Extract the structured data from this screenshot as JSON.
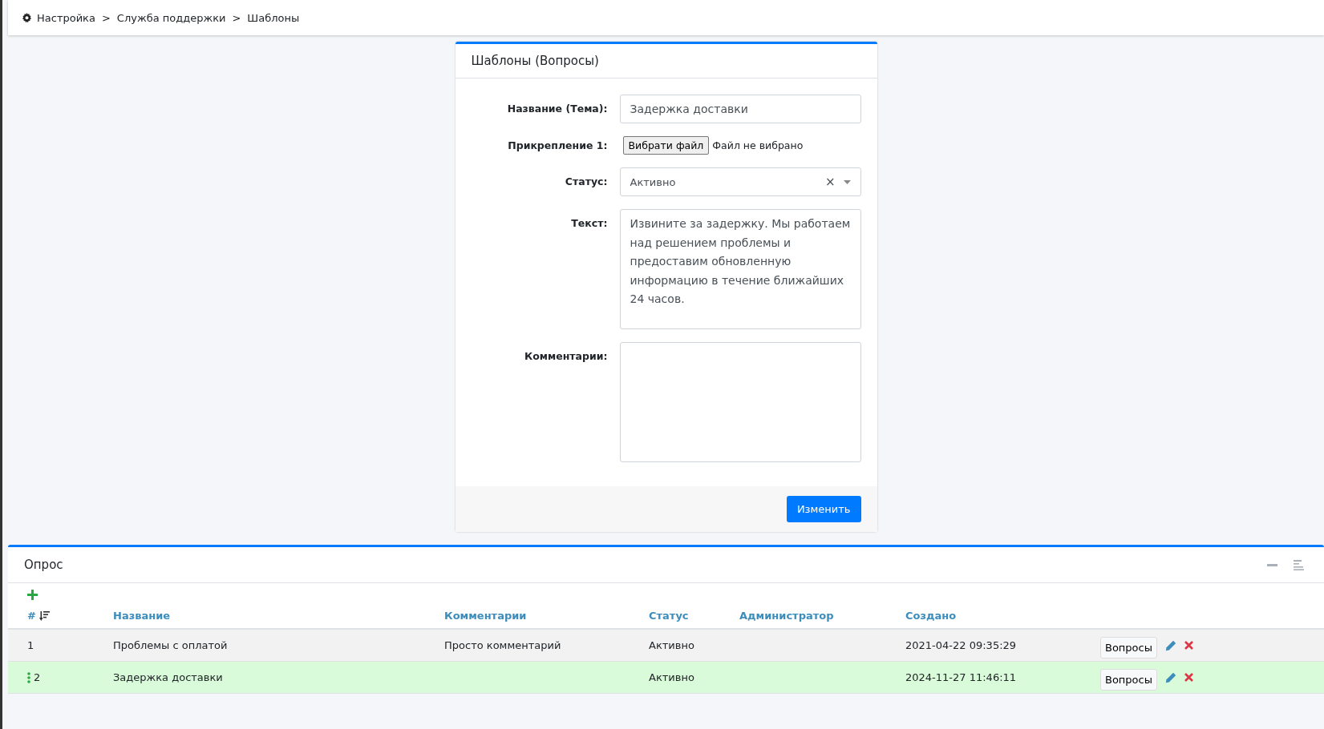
{
  "breadcrumb": [
    "Настройка",
    "Служба поддержки",
    "Шаблоны"
  ],
  "breadcrumb_separator": ">",
  "form": {
    "title": "Шаблоны (Вопросы)",
    "fields": [
      {
        "kind": "input",
        "label": "Название (Тема):",
        "value": "Задержка доставки"
      },
      {
        "kind": "file",
        "label": "Прикрепление 1:",
        "button": "Вибрати файл",
        "value": "Файл не вибрано"
      },
      {
        "kind": "select",
        "label": "Статус:",
        "value": "Активно",
        "clear": "×"
      },
      {
        "kind": "textarea",
        "label": "Текст:",
        "value": "Извините за задержку. Мы работаем над решением проблемы и предоставим обновленную информацию в течение ближайших 24 часов."
      },
      {
        "kind": "textarea",
        "label": "Комментарии:"
      }
    ],
    "submit": "Изменить"
  },
  "table_panel": {
    "title": "Опрос",
    "columns": [
      "#",
      "Название",
      "Комментарии",
      "Статус",
      "Администратор",
      "Создано"
    ],
    "rows": [
      {
        "cells": [
          "1",
          "Проблемы с оплатой",
          "Просто комментарий",
          "Активно",
          "",
          "2021-04-22 09:35:29"
        ],
        "button": "Вопросы",
        "selected": false
      },
      {
        "cells": [
          "2",
          "Задержка доставки",
          "",
          "Активно",
          "",
          "2024-11-27 11:46:11"
        ],
        "button": "Вопросы",
        "selected": true
      }
    ]
  }
}
